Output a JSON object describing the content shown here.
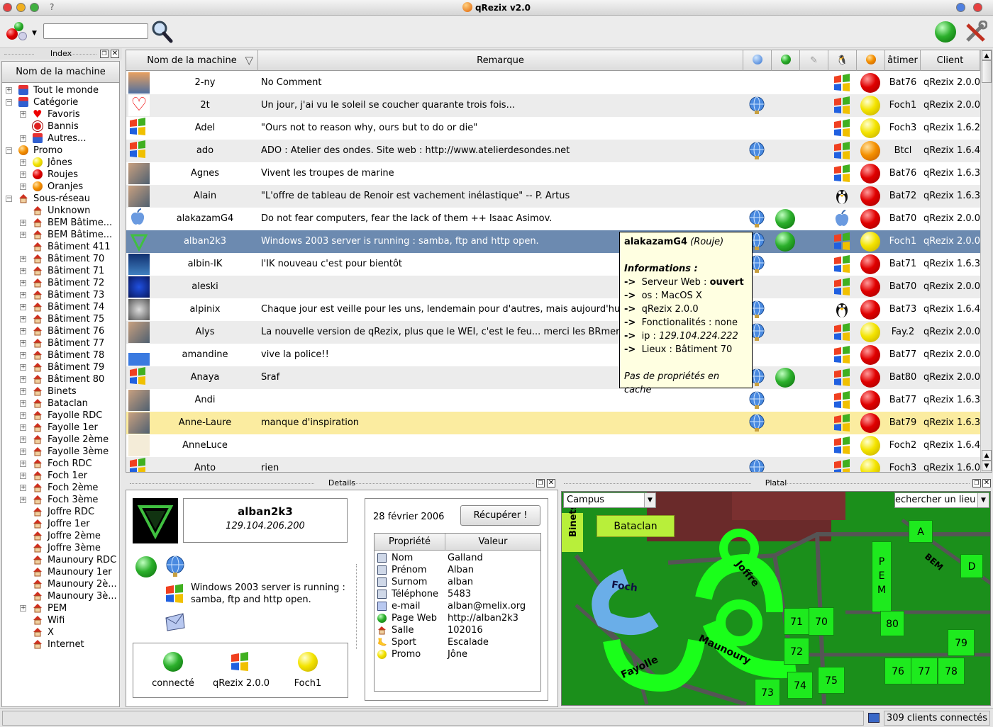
{
  "window": {
    "title": "qRezix v2.0",
    "help_button": "?"
  },
  "toolbar": {
    "search_placeholder": "",
    "search_value": ""
  },
  "index_panel": {
    "title": "Index",
    "column_header": "Nom de la machine"
  },
  "tree": [
    {
      "label": "Tout le monde",
      "level": 0,
      "expander": "+",
      "icon": "folder-icon"
    },
    {
      "label": "Catégorie",
      "level": 0,
      "expander": "-",
      "icon": "folder-icon"
    },
    {
      "label": "Favoris",
      "level": 1,
      "expander": "+",
      "icon": "heart-icon"
    },
    {
      "label": "Bannis",
      "level": 1,
      "expander": "",
      "icon": "ban-icon"
    },
    {
      "label": "Autres...",
      "level": 1,
      "expander": "+",
      "icon": "folder-icon"
    },
    {
      "label": "Promo",
      "level": 0,
      "expander": "-",
      "icon": "orange-ball-icon"
    },
    {
      "label": "Jônes",
      "level": 1,
      "expander": "+",
      "icon": "yellow-ball-icon"
    },
    {
      "label": "Roujes",
      "level": 1,
      "expander": "+",
      "icon": "red-ball-icon"
    },
    {
      "label": "Oranjes",
      "level": 1,
      "expander": "+",
      "icon": "orange-ball-icon"
    },
    {
      "label": "Sous-réseau",
      "level": 0,
      "expander": "-",
      "icon": "house-icon"
    },
    {
      "label": "Unknown",
      "level": 1,
      "expander": "",
      "icon": "house-icon"
    },
    {
      "label": "BEM Bâtime...",
      "level": 1,
      "expander": "+",
      "icon": "house-icon"
    },
    {
      "label": "BEM Bâtime...",
      "level": 1,
      "expander": "+",
      "icon": "house-icon"
    },
    {
      "label": "Bâtiment 411",
      "level": 1,
      "expander": "",
      "icon": "house-icon"
    },
    {
      "label": "Bâtiment 70",
      "level": 1,
      "expander": "+",
      "icon": "house-icon"
    },
    {
      "label": "Bâtiment 71",
      "level": 1,
      "expander": "+",
      "icon": "house-icon"
    },
    {
      "label": "Bâtiment 72",
      "level": 1,
      "expander": "+",
      "icon": "house-icon"
    },
    {
      "label": "Bâtiment 73",
      "level": 1,
      "expander": "+",
      "icon": "house-icon"
    },
    {
      "label": "Bâtiment 74",
      "level": 1,
      "expander": "+",
      "icon": "house-icon"
    },
    {
      "label": "Bâtiment 75",
      "level": 1,
      "expander": "+",
      "icon": "house-icon"
    },
    {
      "label": "Bâtiment 76",
      "level": 1,
      "expander": "+",
      "icon": "house-icon"
    },
    {
      "label": "Bâtiment 77",
      "level": 1,
      "expander": "+",
      "icon": "house-icon"
    },
    {
      "label": "Bâtiment 78",
      "level": 1,
      "expander": "+",
      "icon": "house-icon"
    },
    {
      "label": "Bâtiment 79",
      "level": 1,
      "expander": "+",
      "icon": "house-icon"
    },
    {
      "label": "Bâtiment 80",
      "level": 1,
      "expander": "+",
      "icon": "house-icon"
    },
    {
      "label": "Binets",
      "level": 1,
      "expander": "+",
      "icon": "house-icon"
    },
    {
      "label": "Bataclan",
      "level": 1,
      "expander": "+",
      "icon": "house-icon"
    },
    {
      "label": "Fayolle RDC",
      "level": 1,
      "expander": "+",
      "icon": "house-icon"
    },
    {
      "label": "Fayolle 1er",
      "level": 1,
      "expander": "+",
      "icon": "house-icon"
    },
    {
      "label": "Fayolle 2ème",
      "level": 1,
      "expander": "+",
      "icon": "house-icon"
    },
    {
      "label": "Fayolle 3ème",
      "level": 1,
      "expander": "+",
      "icon": "house-icon"
    },
    {
      "label": "Foch RDC",
      "level": 1,
      "expander": "+",
      "icon": "house-icon"
    },
    {
      "label": "Foch 1er",
      "level": 1,
      "expander": "+",
      "icon": "house-icon"
    },
    {
      "label": "Foch 2ème",
      "level": 1,
      "expander": "+",
      "icon": "house-icon"
    },
    {
      "label": "Foch 3ème",
      "level": 1,
      "expander": "+",
      "icon": "house-icon"
    },
    {
      "label": "Joffre RDC",
      "level": 1,
      "expander": "",
      "icon": "house-icon"
    },
    {
      "label": "Joffre 1er",
      "level": 1,
      "expander": "",
      "icon": "house-icon"
    },
    {
      "label": "Joffre 2ème",
      "level": 1,
      "expander": "",
      "icon": "house-icon"
    },
    {
      "label": "Joffre 3ème",
      "level": 1,
      "expander": "",
      "icon": "house-icon"
    },
    {
      "label": "Maunoury RDC",
      "level": 1,
      "expander": "",
      "icon": "house-icon"
    },
    {
      "label": "Maunoury 1er",
      "level": 1,
      "expander": "",
      "icon": "house-icon"
    },
    {
      "label": "Maunoury 2è...",
      "level": 1,
      "expander": "",
      "icon": "house-icon"
    },
    {
      "label": "Maunoury 3è...",
      "level": 1,
      "expander": "",
      "icon": "house-icon"
    },
    {
      "label": "PEM",
      "level": 1,
      "expander": "+",
      "icon": "house-icon"
    },
    {
      "label": "Wifi",
      "level": 1,
      "expander": "",
      "icon": "house-icon"
    },
    {
      "label": "X",
      "level": 1,
      "expander": "",
      "icon": "house-icon"
    },
    {
      "label": "Internet",
      "level": 1,
      "expander": "",
      "icon": "house-icon"
    }
  ],
  "grid": {
    "columns": {
      "name": "Nom de la machine",
      "remark": "Remarque",
      "building": "âtimer",
      "client": "Client"
    },
    "rows": [
      {
        "name": "2-ny",
        "remark": "No Comment",
        "web": false,
        "ftp": false,
        "os": "windows",
        "promo": "red",
        "building": "Bat76",
        "client": "qRezix 2.0.0",
        "avatar": "sunset",
        "style": ""
      },
      {
        "name": "2t",
        "remark": "Un jour, j'ai vu le soleil se coucher quarante trois fois...",
        "web": true,
        "ftp": false,
        "os": "windows",
        "promo": "yellow",
        "building": "Foch1",
        "client": "qRezix 2.0.0",
        "avatar": "heart",
        "style": "alt"
      },
      {
        "name": "Adel",
        "remark": "\"Ours not to reason why, ours but to do or die\"",
        "web": false,
        "ftp": false,
        "os": "windows",
        "promo": "yellow",
        "building": "Foch3",
        "client": "qRezix 1.6.2",
        "avatar": "windows",
        "style": ""
      },
      {
        "name": "ado",
        "remark": "ADO : Atelier des ondes. Site web : http://www.atelierdesondes.net",
        "web": true,
        "ftp": false,
        "os": "windows",
        "promo": "orange",
        "building": "Btcl",
        "client": "qRezix 1.6.4",
        "avatar": "windows",
        "style": "alt"
      },
      {
        "name": "Agnes",
        "remark": "Vivent les troupes de marine",
        "web": false,
        "ftp": false,
        "os": "windows",
        "promo": "red",
        "building": "Bat76",
        "client": "qRezix 1.6.3",
        "avatar": "photo",
        "style": ""
      },
      {
        "name": "Alain",
        "remark": "\"L'offre de tableau de Renoir est vachement inélastique\" -- P. Artus",
        "web": false,
        "ftp": false,
        "os": "linux",
        "promo": "red",
        "building": "Bat72",
        "client": "qRezix 1.6.3",
        "avatar": "photo",
        "style": "alt"
      },
      {
        "name": "alakazamG4",
        "remark": "Do not fear computers, fear the lack of them ++ Isaac Asimov.",
        "web": true,
        "ftp": true,
        "os": "mac",
        "promo": "red",
        "building": "Bat70",
        "client": "qRezix 2.0.0",
        "avatar": "apple",
        "style": ""
      },
      {
        "name": "alban2k3",
        "remark": "Windows 2003 server is running : samba, ftp and http open.",
        "web": true,
        "ftp": true,
        "os": "windows",
        "promo": "yellow",
        "building": "Foch1",
        "client": "qRezix 2.0.0",
        "avatar": "logo",
        "style": "sel"
      },
      {
        "name": "albin-IK",
        "remark": "l'IK nouveau c'est pour bientôt",
        "web": true,
        "ftp": false,
        "os": "windows",
        "promo": "red",
        "building": "Bat71",
        "client": "qRezix 1.6.3",
        "avatar": "palm",
        "style": ""
      },
      {
        "name": "aleski",
        "remark": "",
        "web": false,
        "ftp": false,
        "os": "windows",
        "promo": "red",
        "building": "Bat70",
        "client": "qRezix 2.0.0",
        "avatar": "blue",
        "style": "alt"
      },
      {
        "name": "alpinix",
        "remark": "Chaque jour est veille pour les uns, lendemain pour d'autres, mais aujourd'hui p",
        "web": true,
        "ftp": false,
        "os": "linux",
        "promo": "red",
        "building": "Bat73",
        "client": "qRezix 1.6.4",
        "avatar": "egg",
        "style": ""
      },
      {
        "name": "Alys",
        "remark": "La nouvelle version de qRezix, plus que le WEI, c'est le feu... merci les BRmen",
        "web": true,
        "ftp": false,
        "os": "windows",
        "promo": "yellow",
        "building": "Fay.2",
        "client": "qRezix 2.0.0",
        "avatar": "photo",
        "style": "alt"
      },
      {
        "name": "amandine",
        "remark": "vive la police!!",
        "web": false,
        "ftp": false,
        "os": "windows",
        "promo": "red",
        "building": "Bat77",
        "client": "qRezix 2.0.0",
        "avatar": "smurf",
        "style": ""
      },
      {
        "name": "Anaya",
        "remark": "Sraf",
        "web": true,
        "ftp": true,
        "os": "windows",
        "promo": "red",
        "building": "Bat80",
        "client": "qRezix 2.0.0",
        "avatar": "windows",
        "style": "alt"
      },
      {
        "name": "Andi",
        "remark": "",
        "web": true,
        "ftp": false,
        "os": "windows",
        "promo": "red",
        "building": "Bat77",
        "client": "qRezix 1.6.3",
        "avatar": "photo",
        "style": ""
      },
      {
        "name": "Anne-Laure",
        "remark": "manque d'inspiration",
        "web": true,
        "ftp": false,
        "os": "windows",
        "promo": "red",
        "building": "Bat79",
        "client": "qRezix 1.6.3",
        "avatar": "photo",
        "style": "hl"
      },
      {
        "name": "AnneLuce",
        "remark": "",
        "web": false,
        "ftp": false,
        "os": "windows",
        "promo": "yellow",
        "building": "Foch2",
        "client": "qRezix 1.6.4",
        "avatar": "harp",
        "style": ""
      },
      {
        "name": "Anto",
        "remark": "rien",
        "web": true,
        "ftp": false,
        "os": "windows",
        "promo": "yellow",
        "building": "Foch3",
        "client": "qRezix 1.6.0",
        "avatar": "windows",
        "style": "alt"
      }
    ]
  },
  "tooltip": {
    "name": "alakazamG4",
    "promo": "(Rouje)",
    "section": "Informations :",
    "arrow": "->",
    "web_label": "Serveur Web : ",
    "web_value": "ouvert",
    "os": "os : MacOS X",
    "client": "qRezix 2.0.0",
    "features": "Fonctionalités : none",
    "ip_label": "ip : ",
    "ip_value": "129.104.224.222",
    "location": "Lieux : Bâtiment 70",
    "cache": "Pas de propriétés en cache"
  },
  "details": {
    "title": "Details",
    "name": "alban2k3",
    "ip": "129.104.206.200",
    "remark": "Windows 2003 server is running : samba, ftp and http open.",
    "status_connected": "connecté",
    "status_client": "qRezix 2.0.0",
    "status_building": "Foch1",
    "date": "28 février 2006",
    "fetch_button": "Récupérer !",
    "prop_header": "Propriété",
    "value_header": "Valeur",
    "properties": [
      {
        "name": "Nom",
        "value": "Galland",
        "icon": "computer-icon"
      },
      {
        "name": "Prénom",
        "value": "Alban",
        "icon": "computer-icon"
      },
      {
        "name": "Surnom",
        "value": "alban",
        "icon": "computer-icon"
      },
      {
        "name": "Téléphone",
        "value": "5483",
        "icon": "computer-icon"
      },
      {
        "name": "e-mail",
        "value": "alban@melix.org",
        "icon": "envelope-icon"
      },
      {
        "name": "Page Web",
        "value": "http://alban2k3",
        "icon": "globe-icon"
      },
      {
        "name": "Salle",
        "value": "102016",
        "icon": "house-icon"
      },
      {
        "name": "Sport",
        "value": "Escalade",
        "icon": "sport-icon"
      },
      {
        "name": "Promo",
        "value": "Jône",
        "icon": "yellow-ball-icon"
      }
    ]
  },
  "platal": {
    "title": "Platal",
    "map_select": "Campus",
    "place_search": "echercher un lieu",
    "labels": {
      "binets": "Binets",
      "bataclan": "Bataclan",
      "foch": "Foch",
      "joffre": "Joffre",
      "maunoury": "Maunoury",
      "fayolle": "Fayolle",
      "pem": "P E M",
      "bem": "BEM",
      "a": "A",
      "d": "D"
    },
    "buildings": [
      "71",
      "70",
      "80",
      "79",
      "72",
      "76",
      "77",
      "78",
      "75",
      "74",
      "73"
    ]
  },
  "status": {
    "clients": "309 clients connectés"
  }
}
